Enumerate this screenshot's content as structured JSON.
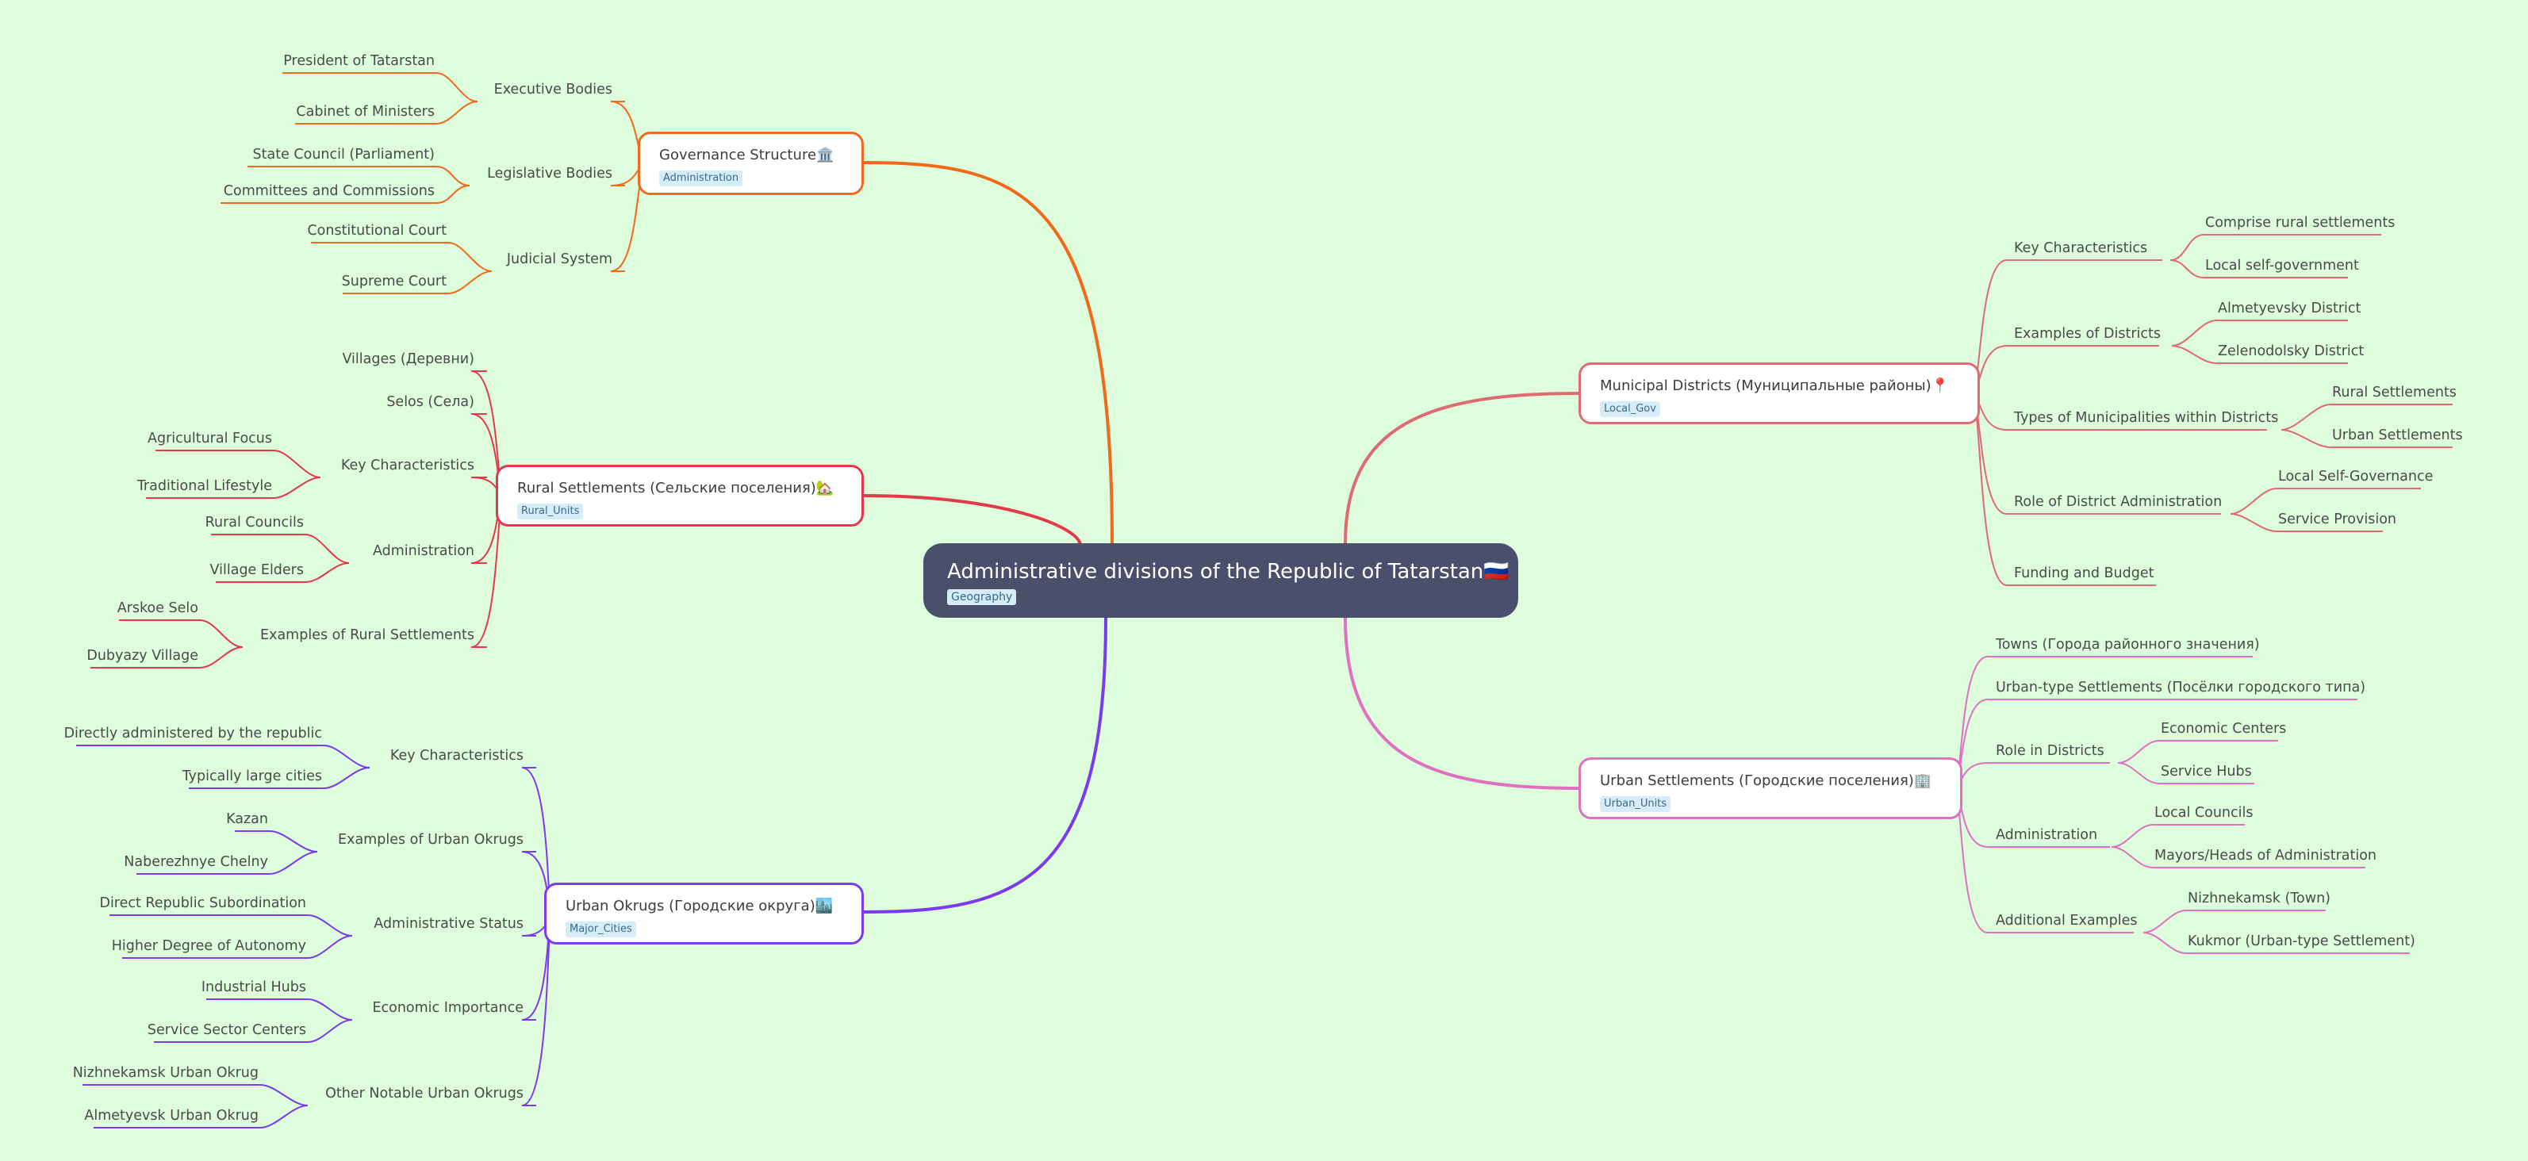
{
  "root": {
    "title": "Administrative divisions of the Republic of Tatarstan🇷🇺",
    "tag": "Geography"
  },
  "colors": {
    "governance": "#f06a1a",
    "rural": "#e23a4a",
    "urban_okrugs": "#7c3aed",
    "municipal": "#e06a72",
    "urban_settlements": "#e070c0"
  },
  "branches": {
    "governance": {
      "title": "Governance Structure🏛️",
      "tag": "Administration",
      "children": [
        {
          "label": "Executive Bodies",
          "children": [
            "President of Tatarstan",
            "Cabinet of Ministers"
          ]
        },
        {
          "label": "Legislative Bodies",
          "children": [
            "State Council (Parliament)",
            "Committees and Commissions"
          ]
        },
        {
          "label": "Judicial System",
          "children": [
            "Constitutional Court",
            "Supreme Court"
          ]
        }
      ]
    },
    "rural": {
      "title": "Rural Settlements (Сельские поселения)🏡",
      "tag": "Rural_Units",
      "children": [
        {
          "label": "Villages (Деревни)",
          "children": []
        },
        {
          "label": "Selos (Села)",
          "children": []
        },
        {
          "label": "Key Characteristics",
          "children": [
            "Agricultural Focus",
            "Traditional Lifestyle"
          ]
        },
        {
          "label": "Administration",
          "children": [
            "Rural Councils",
            "Village Elders"
          ]
        },
        {
          "label": "Examples of Rural Settlements",
          "children": [
            "Arskoe Selo",
            "Dubyazy Village"
          ]
        }
      ]
    },
    "urban_okrugs": {
      "title": "Urban Okrugs (Городские округа)🏙️",
      "tag": "Major_Cities",
      "children": [
        {
          "label": "Key Characteristics",
          "children": [
            "Directly administered by the republic",
            "Typically large cities"
          ]
        },
        {
          "label": "Examples of Urban Okrugs",
          "children": [
            "Kazan",
            "Naberezhnye Chelny"
          ]
        },
        {
          "label": "Administrative Status",
          "children": [
            "Direct Republic Subordination",
            "Higher Degree of Autonomy"
          ]
        },
        {
          "label": "Economic Importance",
          "children": [
            "Industrial Hubs",
            "Service Sector Centers"
          ]
        },
        {
          "label": "Other Notable Urban Okrugs",
          "children": [
            "Nizhnekamsk Urban Okrug",
            "Almetyevsk Urban Okrug"
          ]
        }
      ]
    },
    "municipal": {
      "title": "Municipal Districts (Муниципальные районы)📍",
      "tag": "Local_Gov",
      "children": [
        {
          "label": "Key Characteristics",
          "children": [
            "Comprise rural settlements",
            "Local self-government"
          ]
        },
        {
          "label": "Examples of Districts",
          "children": [
            "Almetyevsky District",
            "Zelenodolsky District"
          ]
        },
        {
          "label": "Types of Municipalities within Districts",
          "children": [
            "Rural Settlements",
            "Urban Settlements"
          ]
        },
        {
          "label": "Role of District Administration",
          "children": [
            "Local Self-Governance",
            "Service Provision"
          ]
        },
        {
          "label": "Funding and Budget",
          "children": []
        }
      ]
    },
    "urban_settlements": {
      "title": "Urban Settlements (Городские поселения)🏢",
      "tag": "Urban_Units",
      "children": [
        {
          "label": "Towns (Города районного значения)",
          "children": []
        },
        {
          "label": "Urban-type Settlements (Посёлки городского типа)",
          "children": []
        },
        {
          "label": "Role in Districts",
          "children": [
            "Economic Centers",
            "Service Hubs"
          ]
        },
        {
          "label": "Administration",
          "children": [
            "Local Councils",
            "Mayors/Heads of Administration"
          ]
        },
        {
          "label": "Additional Examples",
          "children": [
            "Nizhnekamsk (Town)",
            "Kukmor (Urban-type Settlement)"
          ]
        }
      ]
    }
  }
}
